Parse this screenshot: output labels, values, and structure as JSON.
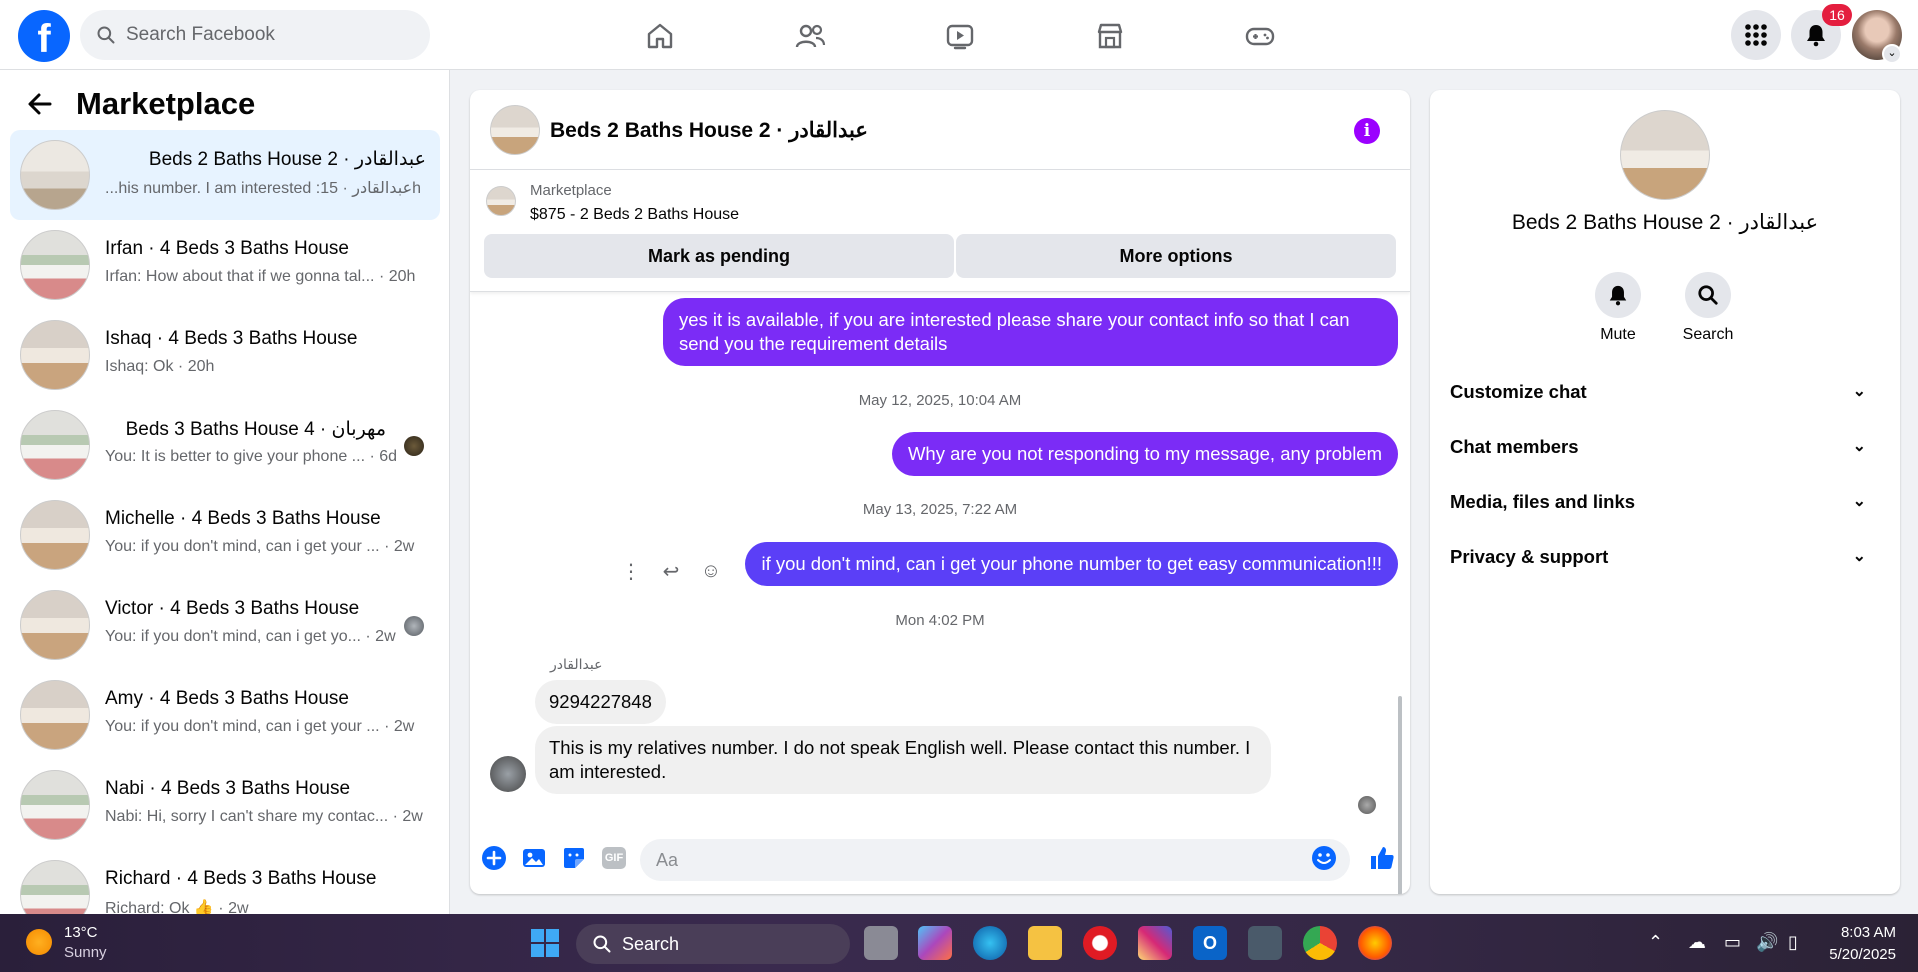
{
  "topbar": {
    "logo_letter": "f",
    "search_placeholder": "Search Facebook",
    "notification_count": "16"
  },
  "sidebar": {
    "title": "Marketplace",
    "conversations": [
      {
        "title": "Beds 2 Baths House 2 · عبدالقادر",
        "preview": "...his number. I am interested :عبدالقادر",
        "time": "15h",
        "active": true
      },
      {
        "title": "Irfan · 4 Beds 3 Baths House",
        "preview": "Irfan: How about that if we gonna tal...",
        "time": "20h"
      },
      {
        "title": "Ishaq · 4 Beds 3 Baths House",
        "preview": "Ishaq: Ok",
        "time": "20h"
      },
      {
        "title": "Beds 3 Baths House 4 · مهربان",
        "preview": "You: It is better to give your phone ...",
        "time": "6d"
      },
      {
        "title": "Michelle · 4 Beds 3 Baths House",
        "preview": "You: if you don't mind, can i get your ...",
        "time": "2w"
      },
      {
        "title": "Victor · 4 Beds 3 Baths House",
        "preview": "You: if you don't mind, can i get yo...",
        "time": "2w"
      },
      {
        "title": "Amy · 4 Beds 3 Baths House",
        "preview": "You: if you don't mind, can i get your ...",
        "time": "2w"
      },
      {
        "title": "Nabi · 4 Beds 3 Baths House",
        "preview": "Nabi: Hi, sorry I can't share my contac...",
        "time": "2w"
      },
      {
        "title": "Richard · 4 Beds 3 Baths House",
        "preview": "Richard: Ok 👍",
        "time": "2w"
      }
    ]
  },
  "chat": {
    "name": "Beds 2 Baths House 2 · عبدالقادر",
    "listing_source": "Marketplace",
    "listing_title": "$875 - 2 Beds 2 Baths House",
    "btn_pending": "Mark as pending",
    "btn_more": "More options",
    "messages": {
      "out1": "yes it is available, if you are interested please share your contact info so that I can send you the requirement details",
      "ts1": "May 12, 2025, 10:04 AM",
      "out2": "Why are you not responding to my message, any problem",
      "ts2": "May 13, 2025, 7:22 AM",
      "out3": "if you don't mind, can i get your phone number to get easy communication!!!",
      "ts3": "Mon 4:02 PM",
      "sender": "عبدالقادر",
      "in1": "9294227848",
      "in2": "This is my relatives number. I do not speak English well. Please contact this number. I am interested."
    },
    "composer_placeholder": "Aa",
    "gif_label": "GIF"
  },
  "details": {
    "name": "Beds 2 Baths House 2 · عبدالقادر",
    "mute_label": "Mute",
    "search_label": "Search",
    "sections": [
      "Customize chat",
      "Chat members",
      "Media, files and links",
      "Privacy & support"
    ]
  },
  "taskbar": {
    "temp": "13°C",
    "weather": "Sunny",
    "search": "Search",
    "time": "8:03 AM",
    "date": "5/20/2025"
  },
  "colors": {
    "brand": "#0866ff",
    "outgoing_bubble": "#7b2cf6",
    "badge": "#e41e3f"
  }
}
